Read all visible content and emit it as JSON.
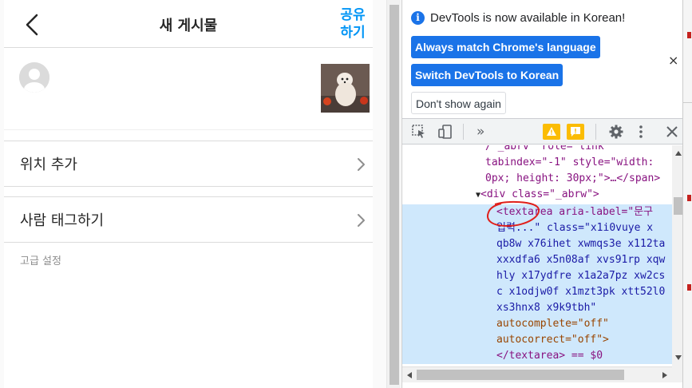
{
  "app": {
    "title": "새 게시물",
    "share_line1": "공유",
    "share_line2": "하기",
    "location_label": "위치 추가",
    "tag_people_label": "사람 태그하기",
    "advanced_label": "고급 설정"
  },
  "devtools": {
    "info_text": "DevTools is now available in Korean!",
    "btn_match": "Always match Chrome's language",
    "btn_switch": "Switch DevTools to Korean",
    "btn_dont_show": "Don't show again",
    "info_close": "×",
    "code_lines": [
      {
        "prefix": "  ",
        "text": "/ _abrv  role= link"
      },
      {
        "prefix": "  ",
        "text": "tabindex=\"-1\" style=\"width:"
      },
      {
        "prefix": "  ",
        "text": "0px; height: 30px;\">…</span>"
      },
      {
        "prefix": "▼",
        "text": "<div class=\"_abrw\">"
      },
      {
        "prefix": "    ",
        "text": "<textarea aria-label=\"문구"
      },
      {
        "prefix": "    ",
        "text": "입력...\" class=\"x1i0vuye x"
      },
      {
        "prefix": "    ",
        "text": "qb8w x76ihet xwmqs3e x112ta"
      },
      {
        "prefix": "    ",
        "text": "xxxdfa6 x5n08af xvs91rp xqw"
      },
      {
        "prefix": "    ",
        "text": "hly x17ydfre x1a2a7pz xw2cs"
      },
      {
        "prefix": "    ",
        "text": "c x1odjw0f x1mzt3pk xtt52l0"
      },
      {
        "prefix": "    ",
        "text": "xs3hnx8 x9k9tbh\""
      },
      {
        "prefix": "    ",
        "text": "autocomplete=\"off\""
      },
      {
        "prefix": "    ",
        "text": "autocorrect=\"off\">"
      },
      {
        "prefix": "    ",
        "text": "</textarea> == $0"
      }
    ]
  },
  "colors": {
    "instagram_blue": "#0095f6",
    "chrome_blue": "#1a73e8",
    "selection": "#cfe8fc",
    "annotation_red": "#e0201b"
  }
}
